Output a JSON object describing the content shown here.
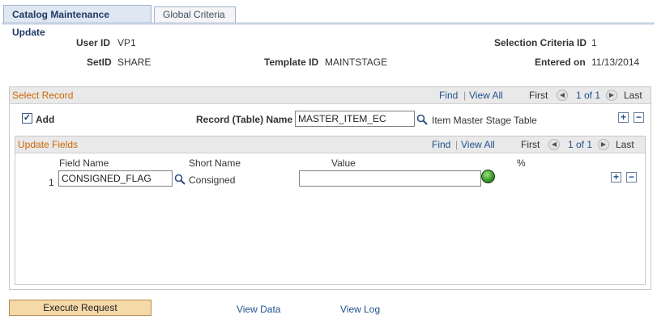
{
  "tabs": [
    {
      "label": "Catalog Maintenance Update",
      "active": true
    },
    {
      "label": "Global Criteria",
      "active": false
    }
  ],
  "header": {
    "user_id_label": "User ID",
    "user_id": "VP1",
    "setid_label": "SetID",
    "setid": "SHARE",
    "template_id_label": "Template ID",
    "template_id": "MAINTSTAGE",
    "selection_criteria_label": "Selection Criteria ID",
    "selection_criteria": "1",
    "entered_on_label": "Entered on",
    "entered_on": "11/13/2014"
  },
  "select_record": {
    "title": "Select Record",
    "find": "Find",
    "sep": "|",
    "view_all": "View All",
    "first": "First",
    "range": "1 of 1",
    "last": "Last",
    "add_label": "Add",
    "add_checked": true,
    "record_label": "Record (Table) Name",
    "record_value": "MASTER_ITEM_EC",
    "record_desc": "Item Master Stage Table",
    "add_row": "+",
    "delete_row": "−"
  },
  "update_fields": {
    "title": "Update Fields",
    "find": "Find",
    "sep": "|",
    "view_all": "View All",
    "first": "First",
    "range": "1 of 1",
    "last": "Last",
    "columns": {
      "field_name": "Field Name",
      "short_name": "Short Name",
      "value": "Value",
      "pct": "%"
    },
    "rows": [
      {
        "num": "1",
        "field_name": "CONSIGNED_FLAG",
        "short_name": "Consigned",
        "value": ""
      }
    ],
    "add_row": "+",
    "delete_row": "−"
  },
  "footer": {
    "execute": "Execute Request",
    "view_data": "View Data",
    "view_log": "View Log"
  },
  "icons": {
    "lookup": "magnifier-icon",
    "prev": "arrow-left-icon",
    "next": "arrow-right-icon",
    "status": "green-status-icon"
  },
  "colors": {
    "section_title": "#cc6600",
    "link": "#21508f",
    "button": "#f6d9a9"
  }
}
